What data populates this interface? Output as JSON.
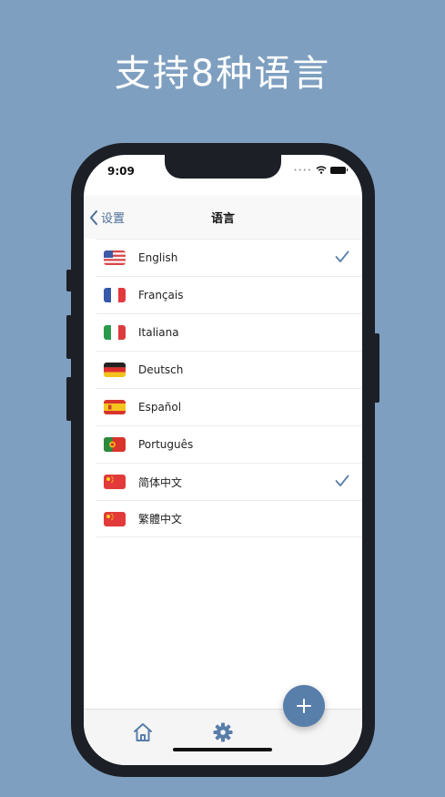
{
  "headline": "支持8种语言",
  "status_bar": {
    "time": "9:09"
  },
  "nav": {
    "back_label": "设置",
    "title": "语言"
  },
  "languages": [
    {
      "label": "English",
      "flag": "us-flag-icon",
      "selected": true
    },
    {
      "label": "Français",
      "flag": "fr-flag-icon",
      "selected": false
    },
    {
      "label": "Italiana",
      "flag": "it-flag-icon",
      "selected": false
    },
    {
      "label": "Deutsch",
      "flag": "de-flag-icon",
      "selected": false
    },
    {
      "label": "Español",
      "flag": "es-flag-icon",
      "selected": false
    },
    {
      "label": "Português",
      "flag": "pt-flag-icon",
      "selected": false
    },
    {
      "label": "简体中文",
      "flag": "cn-flag-icon",
      "selected": true
    },
    {
      "label": "繁體中文",
      "flag": "cn-flag-icon",
      "selected": false
    }
  ],
  "tabbar": {
    "icons": [
      "home-icon",
      "gear-icon"
    ],
    "fab_icon": "plus-icon"
  },
  "colors": {
    "background": "#7e9fc0",
    "accent": "#587eaa",
    "link": "#4d6f98"
  }
}
